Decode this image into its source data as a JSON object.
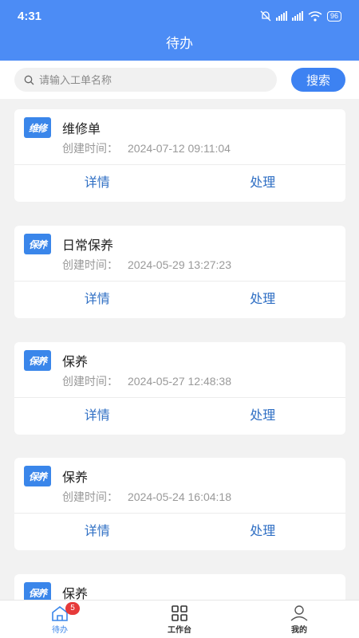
{
  "status_bar": {
    "time": "4:31",
    "battery": "96"
  },
  "header": {
    "title": "待办"
  },
  "search": {
    "placeholder": "请输入工单名称",
    "value": "",
    "button_label": "搜索"
  },
  "orders": [
    {
      "type_icon": "维修",
      "title": "维修单",
      "time_label": "创建时间：",
      "time": "2024-07-12 09:11:04",
      "detail_label": "详情",
      "process_label": "处理"
    },
    {
      "type_icon": "保养",
      "title": "日常保养",
      "time_label": "创建时间：",
      "time": "2024-05-29 13:27:23",
      "detail_label": "详情",
      "process_label": "处理"
    },
    {
      "type_icon": "保养",
      "title": "保养",
      "time_label": "创建时间：",
      "time": "2024-05-27 12:48:38",
      "detail_label": "详情",
      "process_label": "处理"
    },
    {
      "type_icon": "保养",
      "title": "保养",
      "time_label": "创建时间：",
      "time": "2024-05-24 16:04:18",
      "detail_label": "详情",
      "process_label": "处理"
    },
    {
      "type_icon": "保养",
      "title": "保养",
      "time_label": "",
      "time": "",
      "detail_label": "",
      "process_label": ""
    }
  ],
  "tabbar": {
    "items": [
      {
        "label": "待办",
        "icon": "home-icon",
        "badge": "5"
      },
      {
        "label": "工作台",
        "icon": "grid-icon"
      },
      {
        "label": "我的",
        "icon": "user-icon"
      }
    ]
  },
  "colors": {
    "primary": "#4c8cf5",
    "action_text": "#2f6fc4",
    "badge": "#e63a3a"
  }
}
